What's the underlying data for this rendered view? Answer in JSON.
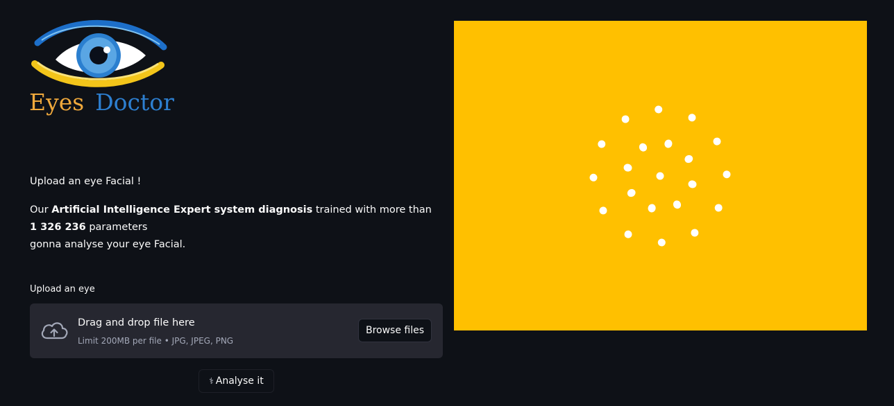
{
  "logo": {
    "word1": "Eyes",
    "word2": "Doctor",
    "colors": {
      "word1": "#f0a93c",
      "word2": "#2d7fd0",
      "iris": "#3b8fd6",
      "brow": "#1d6fc9",
      "lid": "#f3c51a"
    }
  },
  "intro": {
    "line1": "Upload an eye Facial !",
    "p2_prefix": "Our ",
    "p2_bold1": "Artificial Intelligence Expert system diagnosis",
    "p2_mid": " trained with more than ",
    "p2_bold2": "1 326 236",
    "p2_suffix": " parameters",
    "p3": "gonna analyse your eye Facial."
  },
  "uploader": {
    "label": "Upload an eye",
    "drop_text": "Drag and drop file here",
    "limit_text": "Limit 200MB per file • JPG, JPEG, PNG",
    "browse_label": "Browse files",
    "icon": "cloud-upload-icon"
  },
  "analyse_button": {
    "icon": "stethoscope-icon",
    "label": "Analyse it"
  },
  "preview": {
    "background": "#ffc000",
    "content": "loading-spinner-dots"
  },
  "theme": {
    "background": "#0e1117",
    "surface": "#262730",
    "text": "#fafafa"
  }
}
